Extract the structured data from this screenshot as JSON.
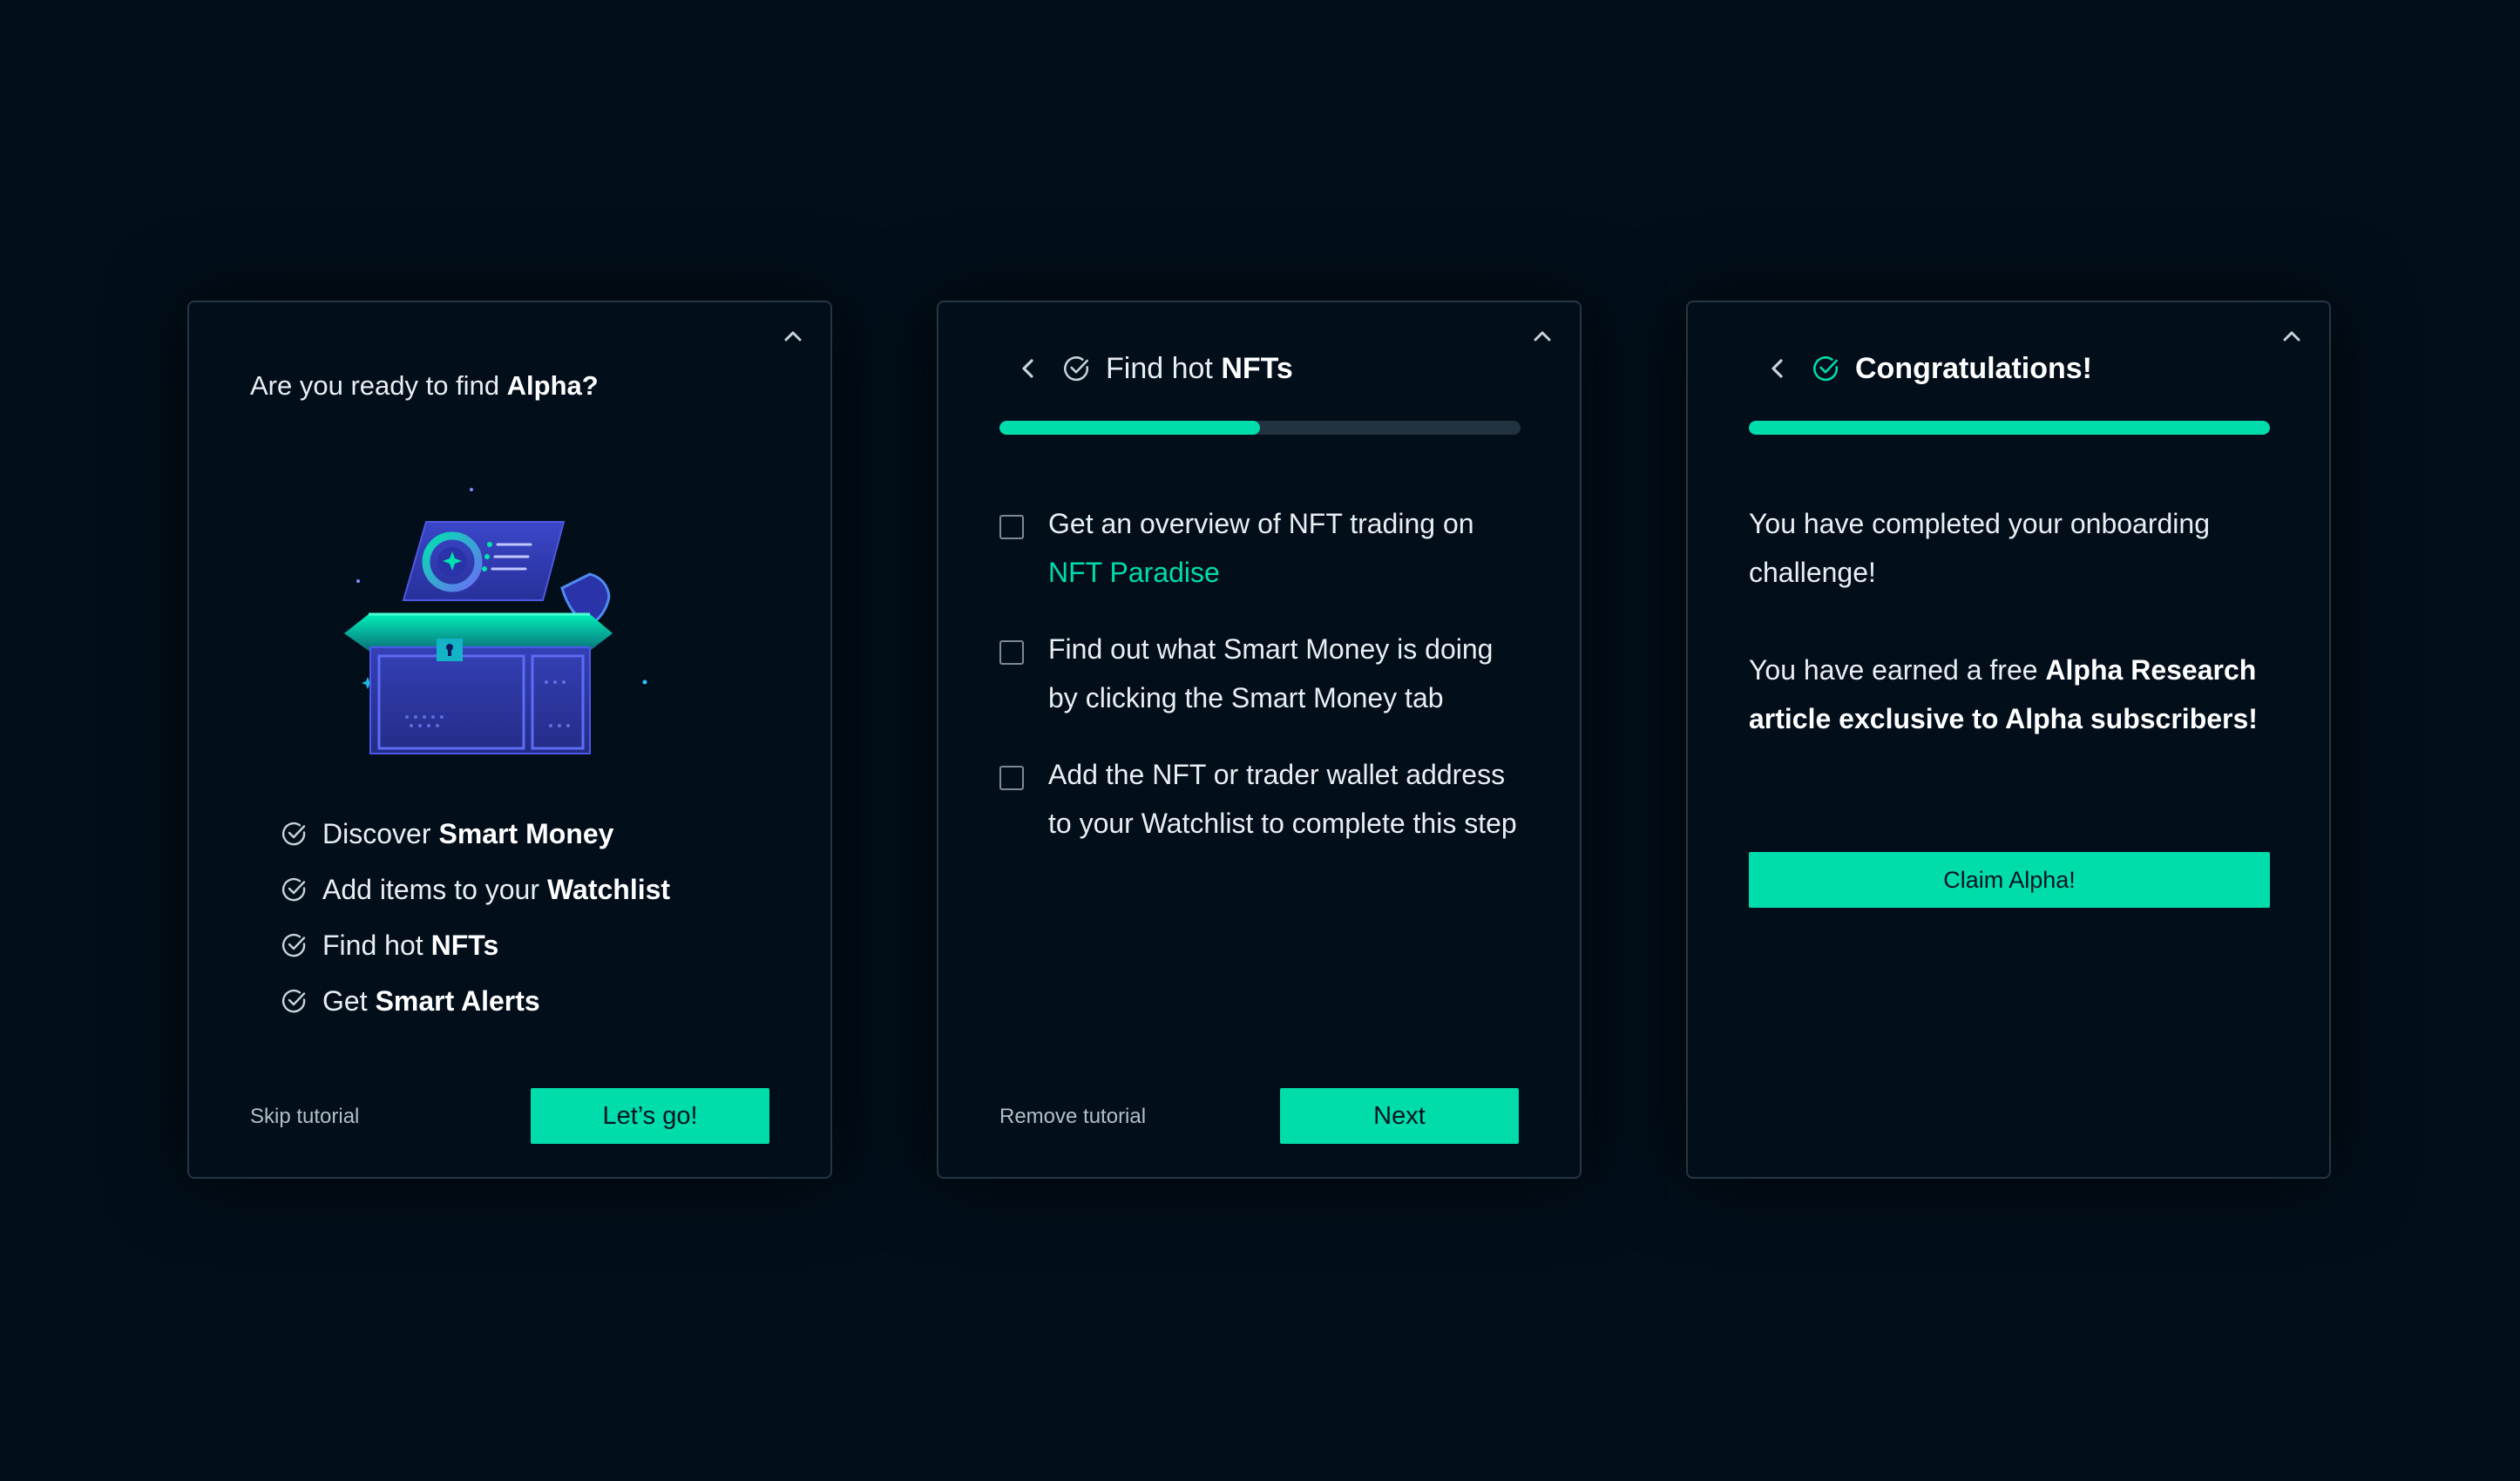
{
  "colors": {
    "background": "#020f1b",
    "accent": "#00dcac",
    "card_border": "#263545",
    "track": "#233240"
  },
  "intro_card": {
    "title_prefix": "Are you ready to find ",
    "title_bold": "Alpha?",
    "illustration": "treasure-chest-illustration",
    "features": [
      {
        "prefix": "Discover",
        "bold": "Smart Money"
      },
      {
        "prefix": "Add items to your",
        "bold": "Watchlist"
      },
      {
        "prefix": "Find hot",
        "bold": "NFTs"
      },
      {
        "prefix": "Get",
        "bold": "Smart Alerts"
      }
    ],
    "skip_label": "Skip tutorial",
    "go_label": "Let’s go!"
  },
  "nfts_card": {
    "title_prefix": "Find hot ",
    "title_bold": "NFTs",
    "progress": 0.5,
    "tasks": [
      {
        "text": "Get an overview of NFT trading on ",
        "link": "NFT Paradise"
      },
      {
        "text": "Find out what Smart Money is doing by clicking the Smart Money tab"
      },
      {
        "text": "Add the NFT or trader wallet address to your Watchlist to complete this step"
      }
    ],
    "remove_label": "Remove tutorial",
    "next_label": "Next"
  },
  "congrats_card": {
    "title": "Congratulations!",
    "progress": 1.0,
    "message1": "You have completed your onboarding challenge!",
    "message2_prefix": "You have earned a free ",
    "message2_bold": "Alpha Research article exclusive to Alpha subscribers!",
    "claim_label": "Claim Alpha!"
  }
}
